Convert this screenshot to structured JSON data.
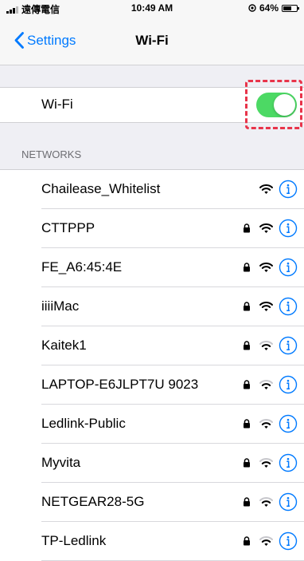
{
  "status_bar": {
    "carrier": "遠傳電信",
    "time": "10:49 AM",
    "battery_text": "64%",
    "battery_level": 0.64,
    "icons": [
      "signal-icon",
      "location-icon",
      "battery-icon"
    ]
  },
  "nav": {
    "back_label": "Settings",
    "title": "Wi-Fi"
  },
  "wifi": {
    "label": "Wi-Fi",
    "enabled": true,
    "toggle_color": "#4cd964",
    "highlight_color": "#e8344a"
  },
  "networks_header": "NETWORKS",
  "networks": [
    {
      "name": "Chailease_Whitelist",
      "secured": false,
      "signal": "full"
    },
    {
      "name": "CTTPPP",
      "secured": true,
      "signal": "full"
    },
    {
      "name": "FE_A6:45:4E",
      "secured": true,
      "signal": "full"
    },
    {
      "name": "iiiiMac",
      "secured": true,
      "signal": "full"
    },
    {
      "name": "Kaitek1",
      "secured": true,
      "signal": "medium"
    },
    {
      "name": "LAPTOP-E6JLPT7U 9023",
      "secured": true,
      "signal": "medium"
    },
    {
      "name": "Ledlink-Public",
      "secured": true,
      "signal": "medium"
    },
    {
      "name": "Myvita",
      "secured": true,
      "signal": "medium"
    },
    {
      "name": "NETGEAR28-5G",
      "secured": true,
      "signal": "medium"
    },
    {
      "name": "TP-Ledlink",
      "secured": true,
      "signal": "medium"
    }
  ],
  "accent_color": "#007aff"
}
